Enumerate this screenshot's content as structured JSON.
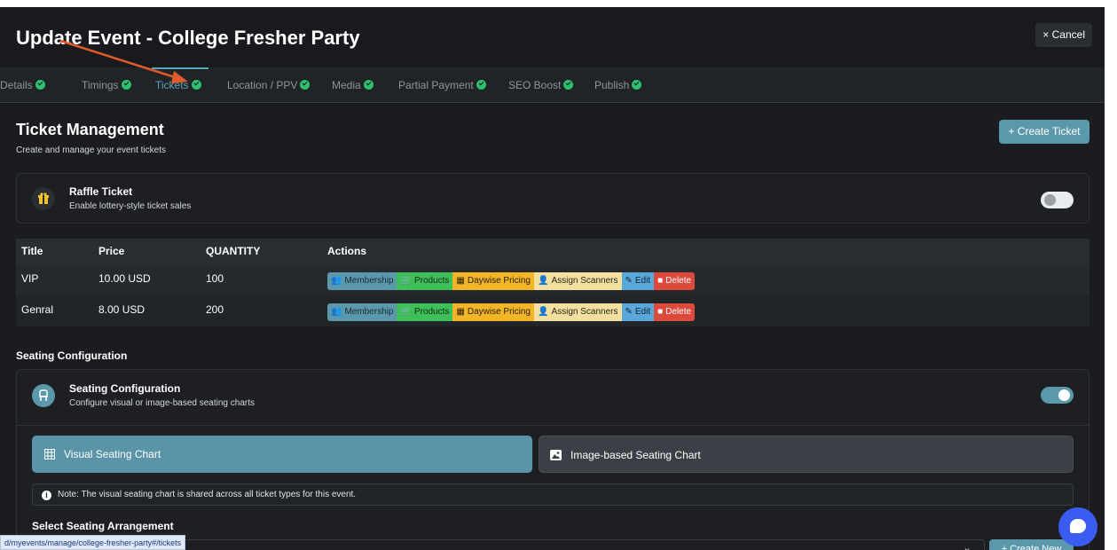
{
  "header": {
    "title": "Update Event - College Fresher Party",
    "cancel_label": "× Cancel"
  },
  "tabs": [
    {
      "label": "Details"
    },
    {
      "label": "Timings"
    },
    {
      "label": "Tickets"
    },
    {
      "label": "Location / PPV"
    },
    {
      "label": "Media"
    },
    {
      "label": "Partial Payment"
    },
    {
      "label": "SEO Boost"
    },
    {
      "label": "Publish"
    }
  ],
  "active_tab": "Tickets",
  "ticket_management": {
    "title": "Ticket Management",
    "subtitle": "Create and manage your event tickets",
    "create_button": "+ Create Ticket"
  },
  "raffle": {
    "title": "Raffle Ticket",
    "subtitle": "Enable lottery-style ticket sales",
    "icon": "gift-icon",
    "enabled": false
  },
  "tickets_table": {
    "headers": [
      "Title",
      "Price",
      "QUANTITY",
      "Actions"
    ],
    "rows": [
      {
        "title": "VIP",
        "price": "10.00 USD",
        "quantity": "100"
      },
      {
        "title": "Genral",
        "price": "8.00 USD",
        "quantity": "200"
      }
    ],
    "actions": {
      "membership": "Membership",
      "products": "Products",
      "daywise": "Daywise Pricing",
      "scanners": "Assign Scanners",
      "edit": "Edit",
      "delete": "Delete"
    }
  },
  "seating": {
    "section_label": "Seating Configuration",
    "card_title": "Seating Configuration",
    "card_subtitle": "Configure visual or image-based seating charts",
    "enabled": true,
    "visual_label": "Visual Seating Chart",
    "image_label": "Image-based Seating Chart",
    "note": "Note: The visual seating chart is shared across all ticket types for this event.",
    "select_label": "Select Seating Arrangement",
    "create_new": "+ Create New"
  },
  "status_url": "d/myevents/manage/college-fresher-party#/tickets",
  "colors": {
    "accent": "#5b98ab",
    "success": "#2fbf71",
    "danger": "#dc4a3c",
    "warning": "#f2b528"
  }
}
